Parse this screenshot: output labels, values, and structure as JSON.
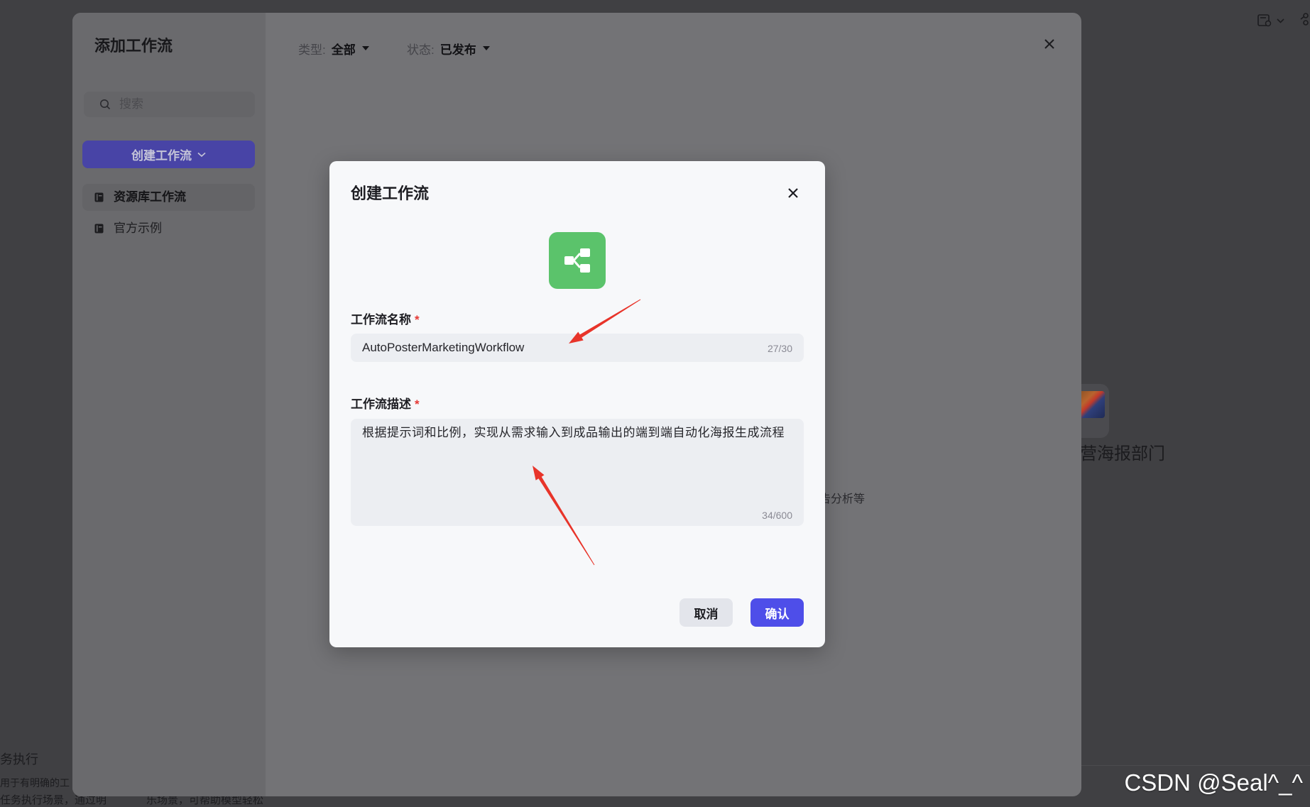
{
  "background": {
    "toolbar_icons": [
      "template-icon",
      "chevron-down-icon",
      "share-icon"
    ],
    "card": {
      "title": "营海报部门",
      "icon": "poster-thumbnail"
    },
    "snippets": [
      "务执行",
      "用于有明确的工",
      "任务执行场景，通过明",
      "乐场景，可帮助模型轻松"
    ]
  },
  "outer_modal": {
    "title": "添加工作流",
    "search": {
      "placeholder": "搜索",
      "icon": "search-icon"
    },
    "create_button": {
      "label": "创建工作流",
      "icon": "chevron-down-icon"
    },
    "nav": [
      {
        "label": "资源库工作流",
        "icon": "library-icon",
        "active": true
      },
      {
        "label": "官方示例",
        "icon": "library-icon",
        "active": false
      }
    ],
    "filters": [
      {
        "label": "类型:",
        "value": "全部"
      },
      {
        "label": "状态:",
        "value": "已发布"
      }
    ],
    "partial_text": "告分析等",
    "close_icon": "close-icon"
  },
  "dialog": {
    "title": "创建工作流",
    "icon": "workflow-icon",
    "name_field": {
      "label": "工作流名称",
      "required": "*",
      "value": "AutoPosterMarketingWorkflow",
      "count": "27/30"
    },
    "desc_field": {
      "label": "工作流描述",
      "required": "*",
      "value": "根据提示词和比例，实现从需求输入到成品输出的端到端自动化海报生成流程",
      "count": "34/600"
    },
    "cancel_label": "取消",
    "confirm_label": "确认"
  },
  "watermark": "CSDN @Seal^_^",
  "colors": {
    "accent": "#4e4ee9",
    "workflow_icon_bg": "#5bc36b",
    "required_mark": "#e53935",
    "annotation_arrow": "#e8342a"
  }
}
